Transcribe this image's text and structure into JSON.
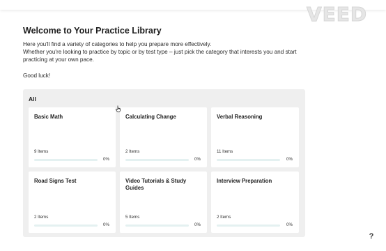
{
  "watermark": "VEED",
  "header": {
    "title": "Welcome to Your Practice Library",
    "intro_line1": "Here you'll find a variety of categories to help you prepare more effectively.",
    "intro_line2": "Whether you're looking to practice by topic or by test type – just pick the category that interests you and start practicing at your own pace.",
    "good_luck": "Good luck!"
  },
  "library": {
    "label": "All",
    "cards": [
      {
        "title": "Basic Math",
        "items": "9 Items",
        "progress": "0%",
        "progress_value": 0
      },
      {
        "title": "Calculating Change",
        "items": "2 Items",
        "progress": "0%",
        "progress_value": 0
      },
      {
        "title": "Verbal Reasoning",
        "items": "11 Items",
        "progress": "0%",
        "progress_value": 0
      },
      {
        "title": "Road Signs Test",
        "items": "2 Items",
        "progress": "0%",
        "progress_value": 0
      },
      {
        "title": "Video Tutorials & Study Guides",
        "items": "5 Items",
        "progress": "0%",
        "progress_value": 0
      },
      {
        "title": "Interview Preparation",
        "items": "2 Items",
        "progress": "0%",
        "progress_value": 0
      }
    ]
  },
  "help": {
    "label": "?"
  },
  "colors": {
    "accent": "#2aa7a7",
    "panel": "#efefef",
    "track": "#e4f1f1"
  },
  "icons": {
    "cursor": "hand-pointer-icon",
    "help": "question-mark-icon"
  }
}
